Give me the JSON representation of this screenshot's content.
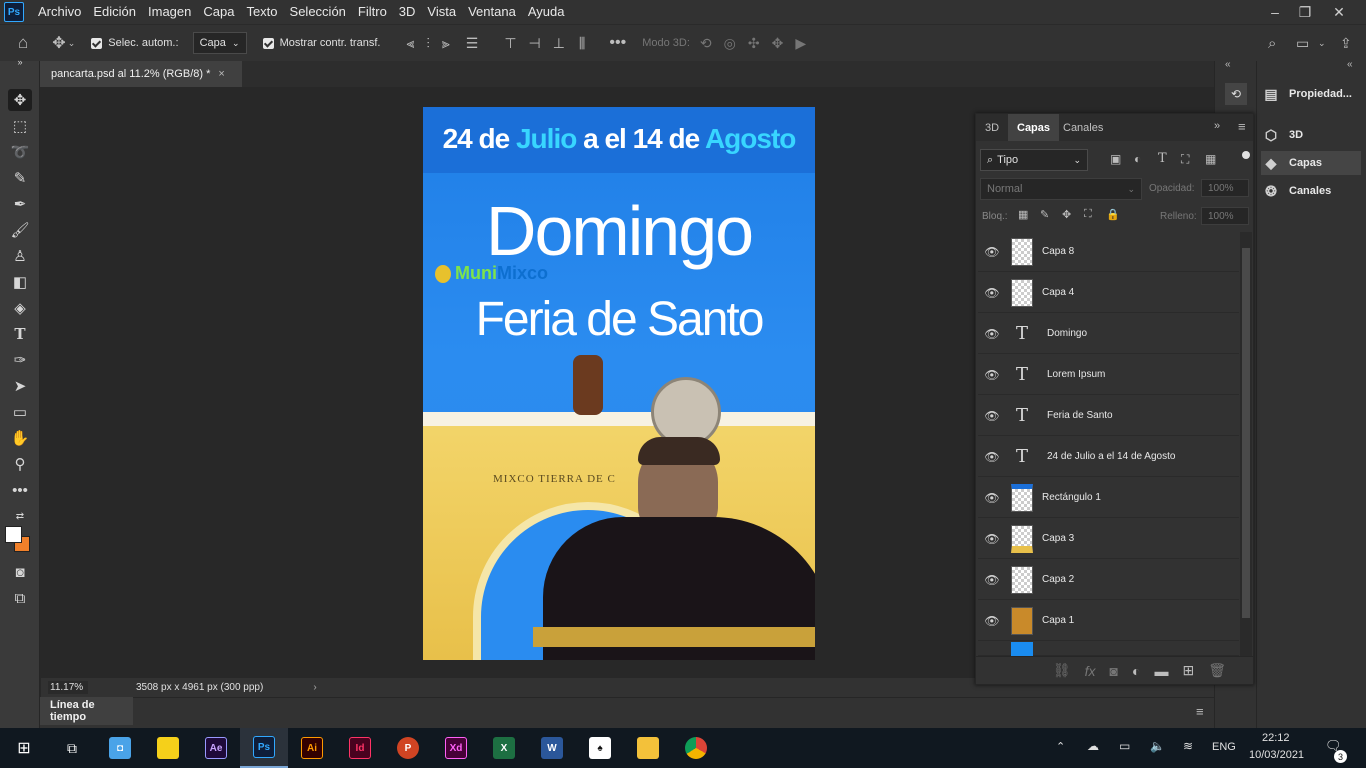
{
  "menubar": {
    "logo": "Ps",
    "items": [
      "Archivo",
      "Edición",
      "Imagen",
      "Capa",
      "Texto",
      "Selección",
      "Filtro",
      "3D",
      "Vista",
      "Ventana",
      "Ayuda"
    ]
  },
  "options": {
    "auto_select_label": "Selec. autom.:",
    "auto_select_value": "Capa",
    "show_transform_label": "Mostrar contr. transf.",
    "mode3d_label": "Modo 3D:"
  },
  "document": {
    "tab_label": "pancarta.psd al 11.2% (RGB/8) *",
    "zoom": "11.17%",
    "dimensions": "3508 px x 4961 px (300 ppp)"
  },
  "poster": {
    "date_part1": "24 de",
    "date_part2": "Julio",
    "date_part3": "a el 14 de",
    "date_part4": "Agosto",
    "title1": "Domingo",
    "title2": "Feria de Santo",
    "logo_a": "Muni",
    "logo_b": "Mixco",
    "arch_text": "MIXCO TIERRA DE C"
  },
  "layers_panel": {
    "tabs": [
      "3D",
      "Capas",
      "Canales"
    ],
    "filter_label": "Tipo",
    "blend_mode": "Normal",
    "opacity_label": "Opacidad:",
    "opacity_value": "100%",
    "lock_label": "Bloq.:",
    "fill_label": "Relleno:",
    "fill_value": "100%",
    "layers": [
      {
        "name": "Capa 8",
        "kind": "pixel"
      },
      {
        "name": "Capa 4",
        "kind": "pixel"
      },
      {
        "name": "Domingo",
        "kind": "text"
      },
      {
        "name": "Lorem Ipsum",
        "kind": "text"
      },
      {
        "name": "Feria de Santo",
        "kind": "text"
      },
      {
        "name": "24 de  Julio a el 14 de  Agosto",
        "kind": "text"
      },
      {
        "name": "Rectángulo 1",
        "kind": "shape"
      },
      {
        "name": "Capa 3",
        "kind": "pixel"
      },
      {
        "name": "Capa 2",
        "kind": "pixel"
      },
      {
        "name": "Capa 1",
        "kind": "pixel"
      }
    ]
  },
  "right_panel": {
    "items": [
      "Propiedad...",
      "3D",
      "Capas",
      "Canales"
    ]
  },
  "timeline": {
    "label": "Línea de tiempo"
  },
  "taskbar": {
    "apps": [
      "Ae",
      "Ps",
      "Ai",
      "Id",
      "P",
      "Xd",
      "X",
      "W"
    ],
    "lang": "ENG",
    "time": "22:12",
    "date": "10/03/2021",
    "notifications": "3"
  }
}
